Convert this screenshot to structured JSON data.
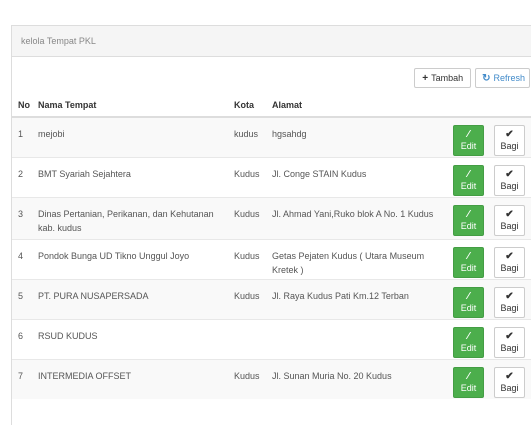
{
  "panel": {
    "title": "kelola Tempat PKL"
  },
  "toolbar": {
    "tambah_label": "Tambah",
    "refresh_label": "Refresh"
  },
  "table": {
    "headers": {
      "no": "No",
      "nama": "Nama Tempat",
      "kota": "Kota",
      "alamat": "Alamat"
    },
    "edit_label": "Edit",
    "bagi_label": "Bagi",
    "rows": [
      {
        "no": "1",
        "nama": "mejobi",
        "kota": "kudus",
        "alamat": "hgsahdg"
      },
      {
        "no": "2",
        "nama": "BMT Syariah Sejahtera",
        "kota": "Kudus",
        "alamat": "Jl. Conge STAIN Kudus"
      },
      {
        "no": "3",
        "nama": "Dinas Pertanian, Perikanan, dan Kehutanan kab. kudus",
        "kota": "Kudus",
        "alamat": "Jl. Ahmad Yani,Ruko blok A No. 1 Kudus"
      },
      {
        "no": "4",
        "nama": "Pondok Bunga UD Tikno Unggul Joyo",
        "kota": "Kudus",
        "alamat": "Getas Pejaten Kudus ( Utara Museum Kretek )"
      },
      {
        "no": "5",
        "nama": "PT. PURA NUSAPERSADA",
        "kota": "Kudus",
        "alamat": "Jl. Raya Kudus Pati Km.12 Terban"
      },
      {
        "no": "6",
        "nama": "RSUD KUDUS",
        "kota": "",
        "alamat": ""
      },
      {
        "no": "7",
        "nama": "INTERMEDIA OFFSET",
        "kota": "Kudus",
        "alamat": "Jl. Sunan Muria No. 20 Kudus"
      }
    ]
  },
  "icons": {
    "plus": "plus-icon",
    "refresh": "refresh-icon",
    "pencil": "pencil-icon",
    "check": "check-icon"
  },
  "colors": {
    "edit_button": "#4cae4c",
    "refresh_text": "#428bca"
  }
}
